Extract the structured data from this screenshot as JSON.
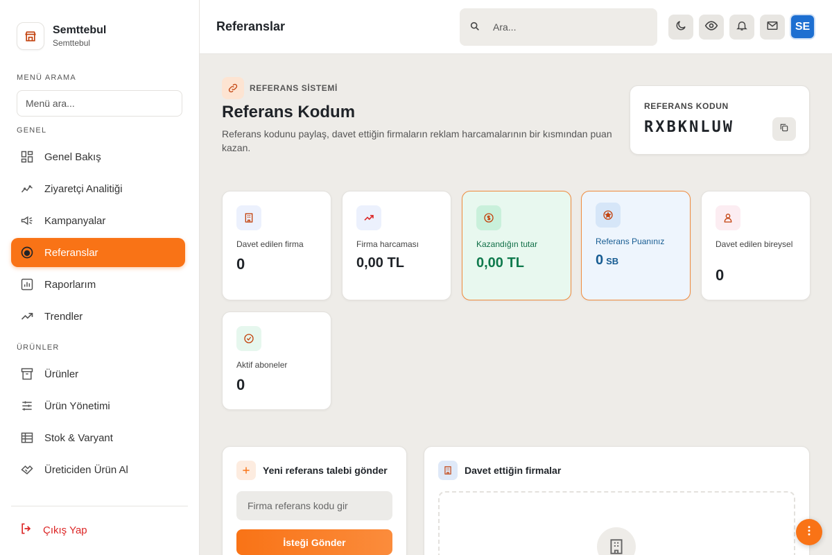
{
  "brand": {
    "name": "Semttebul",
    "subtitle": "Semttebul",
    "icon": "store-icon"
  },
  "sidebar": {
    "menu_search_label": "MENÜ ARAMA",
    "menu_search_placeholder": "Menü ara...",
    "section_general": "GENEL",
    "section_products": "ÜRÜNLER",
    "items": [
      {
        "label": "Genel Bakış",
        "icon": "dashboard-icon",
        "active": false
      },
      {
        "label": "Ziyaretçi Analitiği",
        "icon": "analytics-icon",
        "active": false
      },
      {
        "label": "Kampanyalar",
        "icon": "megaphone-icon",
        "active": false
      },
      {
        "label": "Referanslar",
        "icon": "referral-icon",
        "active": true
      },
      {
        "label": "Raporlarım",
        "icon": "report-icon",
        "active": false
      },
      {
        "label": "Trendler",
        "icon": "trend-icon",
        "active": false
      },
      {
        "label": "Ürünler",
        "icon": "archive-icon",
        "active": false
      },
      {
        "label": "Ürün Yönetimi",
        "icon": "sliders-icon",
        "active": false
      },
      {
        "label": "Stok & Varyant",
        "icon": "table-icon",
        "active": false
      },
      {
        "label": "Üreticiden Ürün Al",
        "icon": "handshake-icon",
        "active": false
      }
    ],
    "logout_label": "Çıkış Yap"
  },
  "header": {
    "title": "Referanslar",
    "search_placeholder": "Ara...",
    "avatar_initials": "SE"
  },
  "hero": {
    "badge": "REFERANS SİSTEMİ",
    "title": "Referans Kodum",
    "description": "Referans kodunu paylaş, davet ettiğin firmaların reklam harcamalarının bir kısmından puan kazan."
  },
  "code_card": {
    "label": "REFERANS KODUN",
    "code": "RXBKNLUW"
  },
  "stats": [
    {
      "label": "Davet edilen firma",
      "value": "0"
    },
    {
      "label": "Firma harcaması",
      "value": "0,00 TL"
    },
    {
      "label": "Kazandığın tutar",
      "value": "0,00 TL"
    },
    {
      "label": "Referans Puanınız",
      "value": "0",
      "unit": "SB"
    },
    {
      "label": "Davet edilen bireysel",
      "value": "0"
    },
    {
      "label": "Aktif aboneler",
      "value": "0"
    }
  ],
  "request_panel": {
    "title": "Yeni referans talebi gönder",
    "input_placeholder": "Firma referans kodu gir",
    "button_label": "İsteği Gönder"
  },
  "invited_panel": {
    "title": "Davet ettiğin firmalar"
  },
  "colors": {
    "accent": "#f97316",
    "avatar": "#1d6fd1",
    "logout": "#dc2626"
  }
}
